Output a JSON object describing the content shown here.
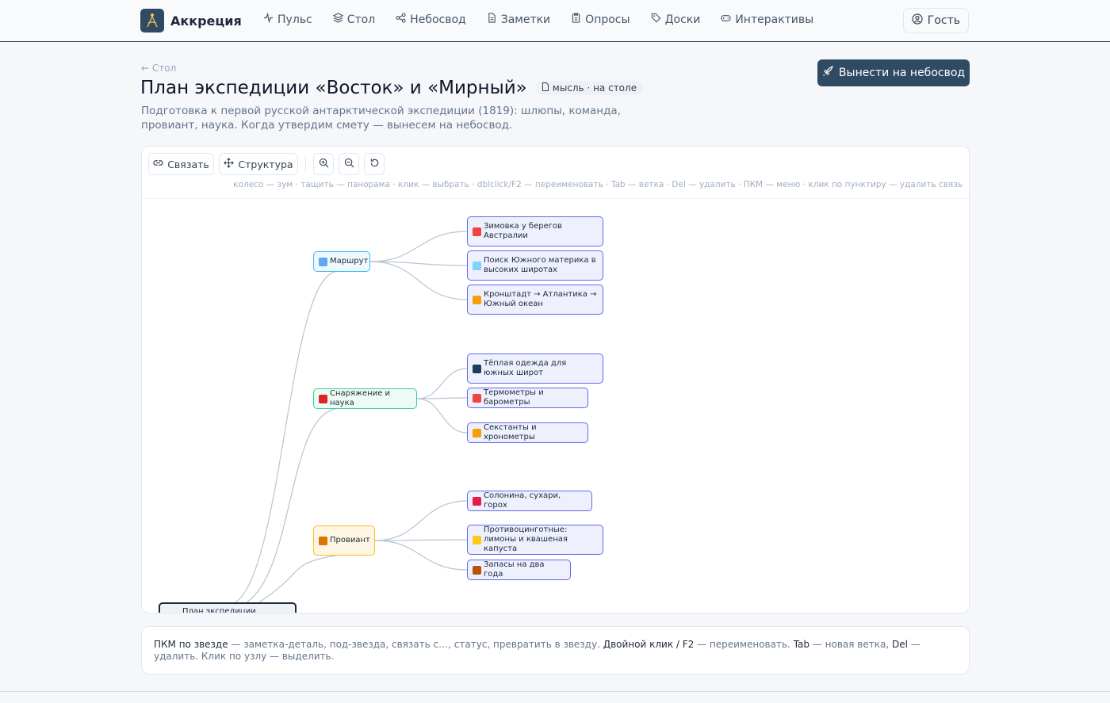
{
  "app": {
    "name": "Аккреция"
  },
  "nav": {
    "items": [
      {
        "label": "Пульс",
        "icon": "pulse-icon"
      },
      {
        "label": "Стол",
        "icon": "layers-icon"
      },
      {
        "label": "Небосвод",
        "icon": "share-icon"
      },
      {
        "label": "Заметки",
        "icon": "document-icon"
      },
      {
        "label": "Опросы",
        "icon": "clipboard-icon"
      },
      {
        "label": "Доски",
        "icon": "tag-icon"
      },
      {
        "label": "Интерактивы",
        "icon": "gamepad-icon"
      }
    ],
    "guest_label": "Гость"
  },
  "page": {
    "back_label": "← Стол",
    "title": "План экспедиции «Восток» и «Мирный»",
    "badge": "мысль · на столе",
    "subtitle": "Подготовка к первой русской антарктической экспедиции (1819): шлюпы, команда, провиант, наука. Когда утвердим смету — вынесем на небосвод.",
    "publish_label": "Вынести на небосвод"
  },
  "toolbar": {
    "link_label": "Связать",
    "structure_label": "Структура",
    "hint": "колесо — зум · тащить — панорама · клик — выбрать · dblclick/F2 — переименовать · Tab — ветка · Del — удалить · ПКМ — меню · клик по пунктиру — удалить связь"
  },
  "mindmap": {
    "root": {
      "label": "План экспедиции"
    },
    "branches": [
      {
        "label": "Маршрут",
        "icon": "map-icon",
        "border": "#38bdf8",
        "fill": "#eef9fe",
        "children": [
          {
            "label": "Зимовка у берегов Австралии",
            "icon": "umbrella-icon"
          },
          {
            "label": "Поиск Южного материка в высоких широтах",
            "icon": "ice-cube-icon"
          },
          {
            "label": "Кронштадт → Атлантика → Южный океан",
            "icon": "compass-icon"
          }
        ]
      },
      {
        "label": "Снаряжение и наука",
        "icon": "backpack-icon",
        "border": "#34d399",
        "fill": "#ecfbf3",
        "children": [
          {
            "label": "Тёплая одежда для южных широт",
            "icon": "coat-icon"
          },
          {
            "label": "Термометры и барометры",
            "icon": "thermometer-icon"
          },
          {
            "label": "Секстанты и хронометры",
            "icon": "compass-icon"
          }
        ]
      },
      {
        "label": "Провиант",
        "icon": "jar-icon",
        "border": "#fbbf24",
        "fill": "#fef6e2",
        "children": [
          {
            "label": "Солонина, сухари, горох",
            "icon": "meat-icon"
          },
          {
            "label": "Противоцинготные: лимоны и квашеная капуста",
            "icon": "lemon-icon"
          },
          {
            "label": "Запасы на два года",
            "icon": "box-icon"
          }
        ]
      }
    ]
  },
  "info": {
    "rmb_label": "ПКМ по звезде",
    "rmb_text": " — заметка-деталь, под-звезда, связать с…, статус, превратить в звезду. ",
    "dbl_label": "Двойной клик / F2",
    "dbl_text": " — переименовать. ",
    "tab_label": "Tab",
    "tab_text": " — новая ветка, ",
    "del_label": "Del",
    "del_text": " — удалить. Клик по узлу — выделить."
  },
  "colors": {
    "accent": "#2f4a63",
    "leaf_border": "#6366f1",
    "leaf_fill": "#eef0fd",
    "edge": "#b8c4d6"
  }
}
